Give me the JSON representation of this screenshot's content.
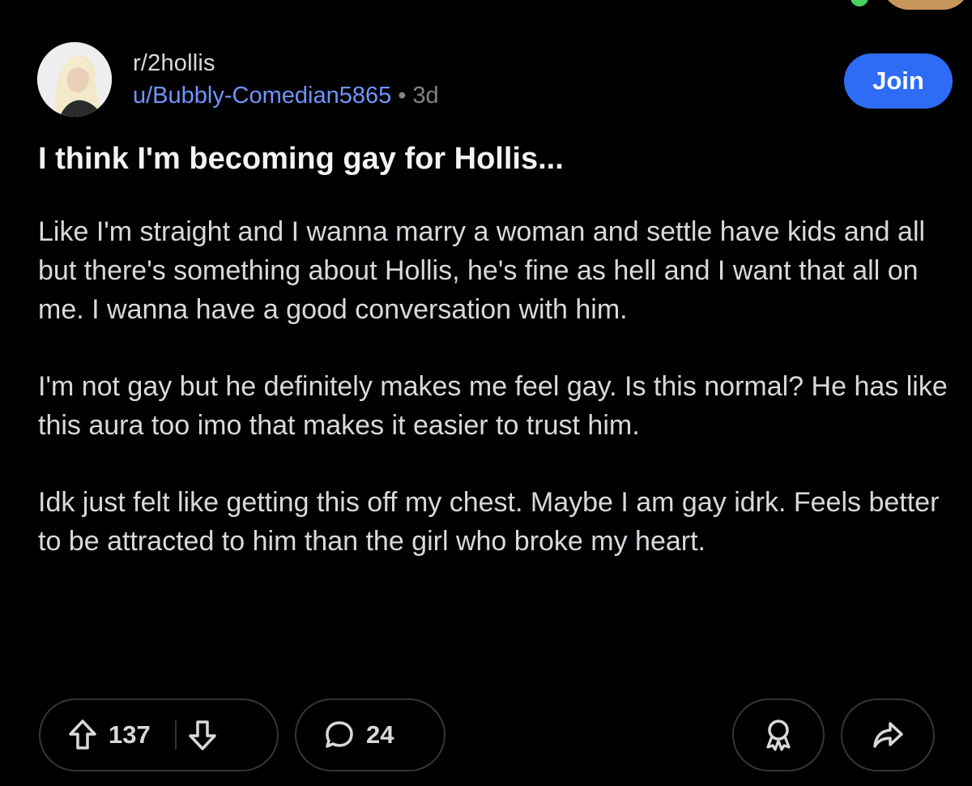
{
  "post": {
    "subreddit": "r/2hollis",
    "author": "u/Bubbly-Comedian5865",
    "separator": "•",
    "age": "3d",
    "join_label": "Join",
    "title": "I think I'm becoming gay for Hollis...",
    "paragraphs": [
      "Like I'm straight and I wanna marry a woman and settle have kids and all but there's something about Hollis, he's fine as hell and I want that all on me. I wanna have a good conversation with him.",
      "I'm not gay but he definitely makes me feel gay. Is this normal? He has like this aura too imo that makes it easier to trust him.",
      "Idk just felt like getting this off my chest. Maybe I am gay idrk. Feels better to be attracted to him than the girl who broke my heart."
    ]
  },
  "actions": {
    "upvote_icon": "upvote-arrow-icon",
    "upvotes": "137",
    "downvote_icon": "downvote-arrow-icon",
    "comment_icon": "speech-bubble-icon",
    "comments": "24",
    "award_icon": "award-ribbon-icon",
    "share_icon": "share-arrow-icon"
  },
  "colors": {
    "background": "#000000",
    "text": "#d7dadc",
    "username": "#7193ff",
    "muted": "#818384",
    "join_button": "#2e6cf6",
    "pill_border": "#343536"
  }
}
